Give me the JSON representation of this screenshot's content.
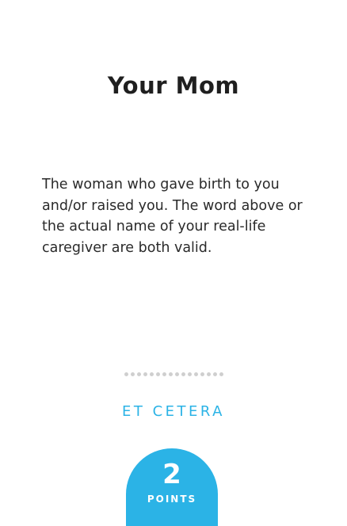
{
  "card": {
    "title": "Your Mom",
    "description": "The woman who gave birth to you and/or raised you. The word above or the actual name of your real-life caregiver are both valid.",
    "category": "ET CETERA",
    "points_value": "2",
    "points_label": "POINTS",
    "accent_color": "#2bb3e6"
  }
}
